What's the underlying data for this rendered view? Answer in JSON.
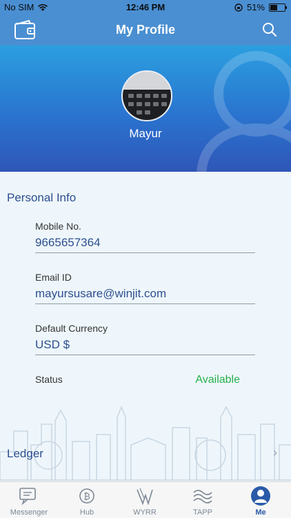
{
  "status_bar": {
    "carrier": "No SIM",
    "time": "12:46 PM",
    "battery": "51%",
    "battery_level": 0.51
  },
  "nav": {
    "title": "My Profile"
  },
  "profile": {
    "name": "Mayur"
  },
  "personal_info": {
    "title": "Personal Info",
    "mobile": {
      "label": "Mobile No.",
      "value": "9665657364"
    },
    "email": {
      "label": "Email ID",
      "value": "mayursusare@winjit.com"
    },
    "currency": {
      "label": "Default Currency",
      "value": "USD $"
    },
    "status": {
      "label": "Status",
      "value": "Available"
    }
  },
  "ledger": {
    "label": "Ledger"
  },
  "tabs": [
    {
      "label": "Messenger",
      "icon": "chat-icon"
    },
    {
      "label": "Hub",
      "icon": "bitcoin-icon"
    },
    {
      "label": "WYRR",
      "icon": "wyrr-icon"
    },
    {
      "label": "TAPP",
      "icon": "wave-icon"
    },
    {
      "label": "Me",
      "icon": "user-icon"
    }
  ],
  "colors": {
    "nav": "#4a8fd2",
    "accent": "#2d4f8f",
    "available": "#24b04a"
  }
}
